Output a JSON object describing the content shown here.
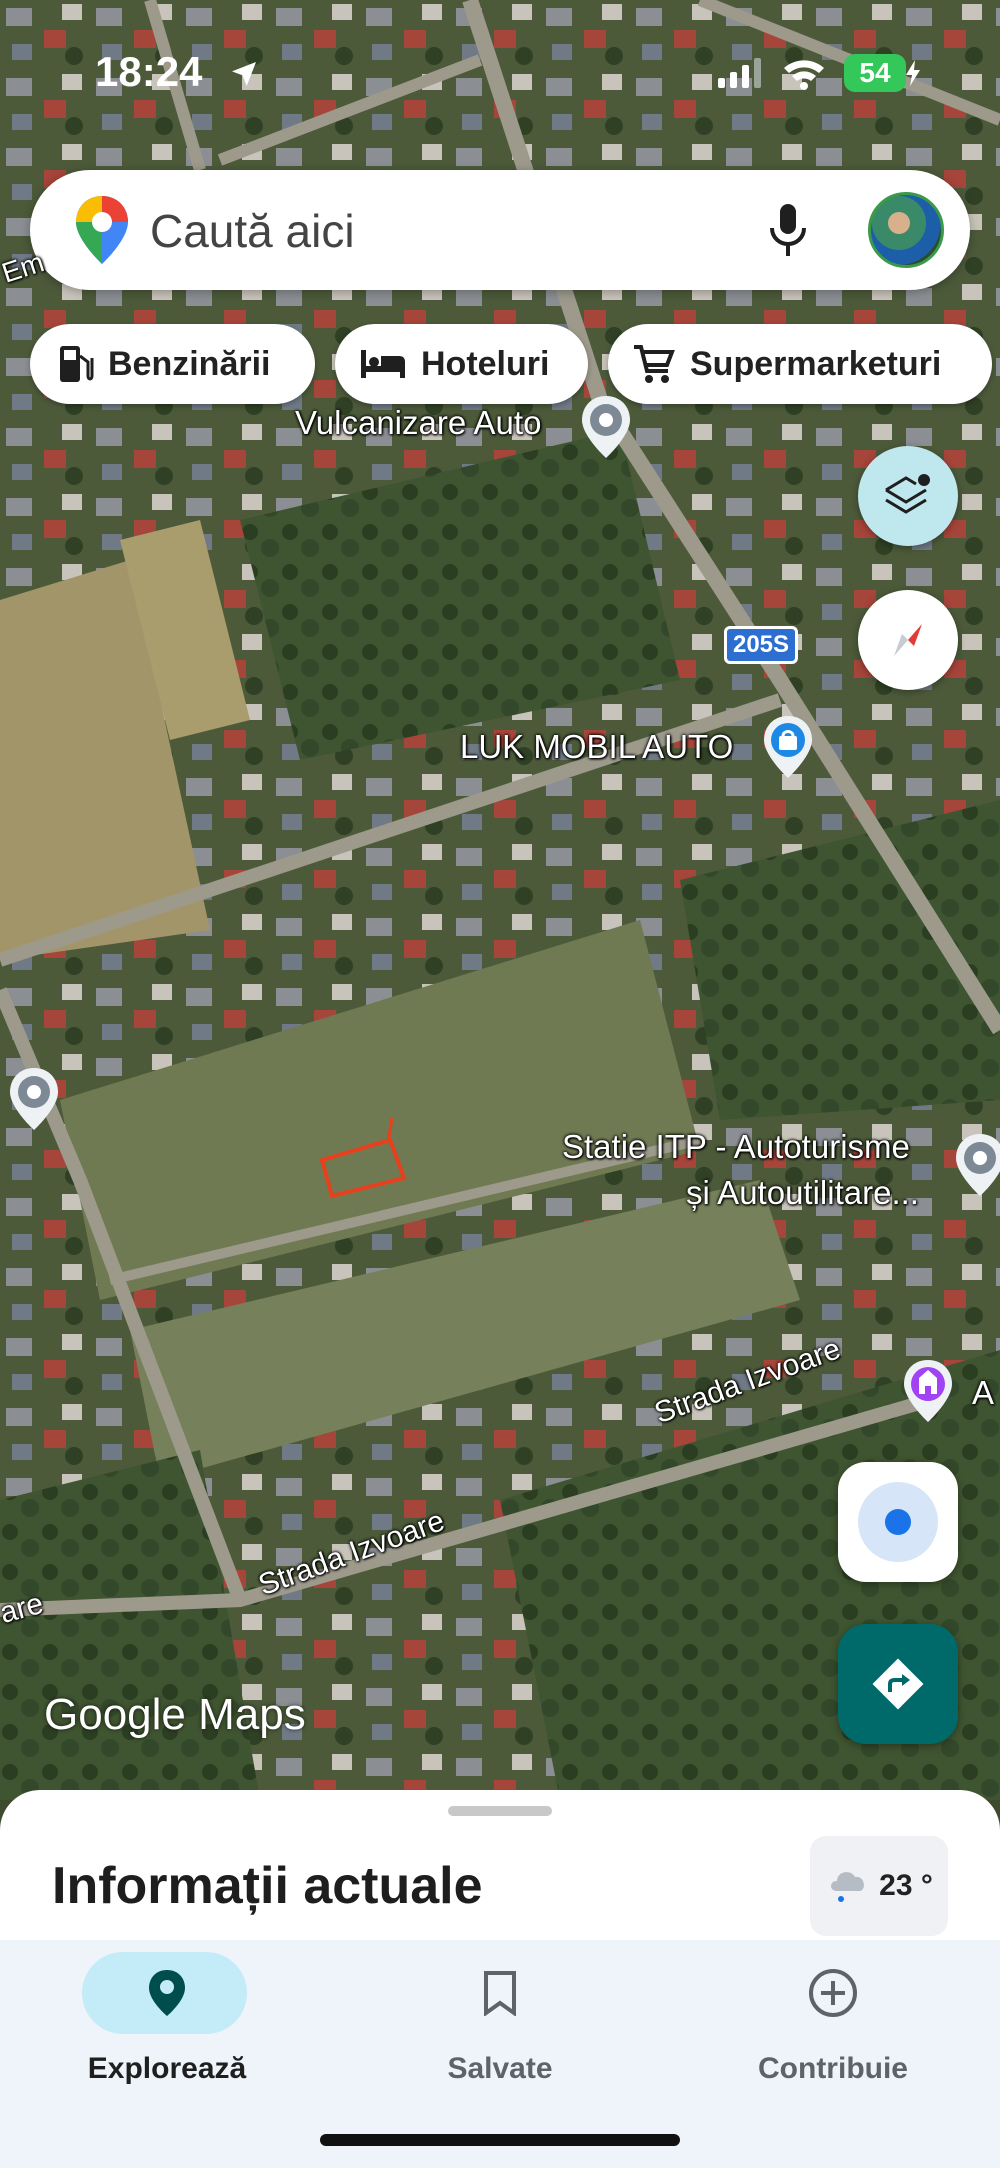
{
  "status": {
    "time": "18:24",
    "battery": "54"
  },
  "search": {
    "placeholder": "Caută aici"
  },
  "chips": [
    {
      "label": "Benzinării",
      "icon": "gas-station-icon"
    },
    {
      "label": "Hoteluri",
      "icon": "bed-icon"
    },
    {
      "label": "Supermarketuri",
      "icon": "cart-icon"
    }
  ],
  "map_labels": {
    "vulcanizare": "Vulcanizare Auto",
    "luk": "LUK MOBIL AUTO",
    "itp_line1": "Statie ITP - Autoturisme",
    "itp_line2": "și Autoutilitare...",
    "street1": "Strada Izvoare",
    "street2": "Strada Izvoare",
    "street_edge": "are",
    "edge_left": "Em",
    "edge_right": "A",
    "road_shield": "205S"
  },
  "watermark": {
    "google": "Google",
    "maps": "Maps"
  },
  "sheet": {
    "title": "Informații actuale",
    "weather": "23 °"
  },
  "nav": [
    {
      "label": "Explorează",
      "icon": "location-pin-icon",
      "active": true
    },
    {
      "label": "Salvate",
      "icon": "bookmark-icon",
      "active": false
    },
    {
      "label": "Contribuie",
      "icon": "add-circle-icon",
      "active": false
    }
  ],
  "colors": {
    "accent": "#006a6a",
    "pill": "#c3ecf8",
    "location_blue": "#1a73e8"
  }
}
